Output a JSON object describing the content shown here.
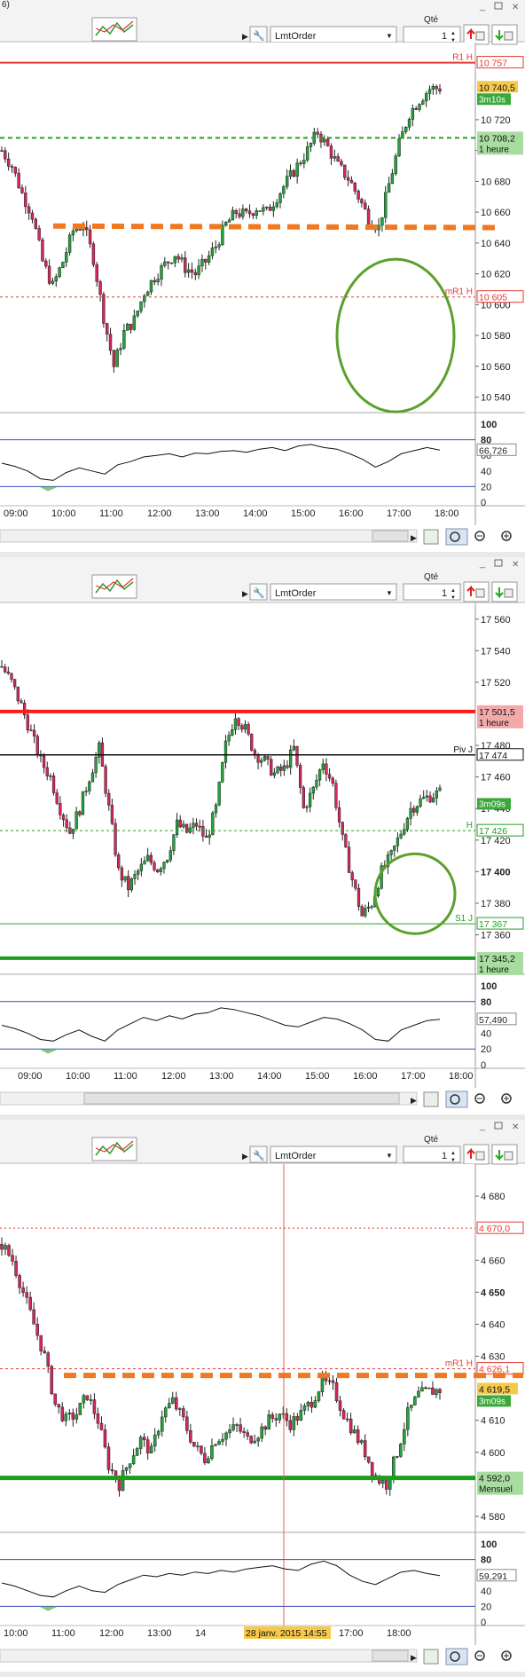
{
  "panels": [
    {
      "window_label": "6)",
      "toolbar": {
        "order_type": "LmtOrder",
        "qty_label": "Qté",
        "qty_value": "1"
      },
      "price_axis": [
        {
          "v": 10720,
          "t": "10 720"
        },
        {
          "v": 10700,
          "t": "10 700"
        },
        {
          "v": 10680,
          "t": "10 680"
        },
        {
          "v": 10660,
          "t": "10 660"
        },
        {
          "v": 10640,
          "t": "10 640"
        },
        {
          "v": 10620,
          "t": "10 620"
        },
        {
          "v": 10600,
          "t": "10 600"
        },
        {
          "v": 10580,
          "t": "10 580"
        },
        {
          "v": 10560,
          "t": "10 560"
        },
        {
          "v": 10540,
          "t": "10 540"
        }
      ],
      "levels": [
        {
          "name": "R1 H",
          "value": 10757,
          "label": "10 757",
          "color": "#e53935",
          "width": 2,
          "dash": "",
          "tag_text": "",
          "tag_bg": ""
        },
        {
          "name": "",
          "value": 10708.2,
          "label": "10 708,2",
          "color": "#22a022",
          "width": 2,
          "dash": "5 4",
          "tag_text": "1 heure",
          "tag_bg": "#a8dca0"
        },
        {
          "name": "mR1 H",
          "value": 10605,
          "label": "10 605",
          "color": "#e53935",
          "width": 1,
          "dash": "3 3",
          "tag_text": "",
          "tag_bg": ""
        }
      ],
      "last_price": {
        "label": "10 740,5",
        "timer": "3m10s"
      },
      "time_labels": [
        "09:00",
        "10:00",
        "11:00",
        "12:00",
        "13:00",
        "14:00",
        "15:00",
        "16:00",
        "17:00",
        "18:00"
      ],
      "osc_axis": [
        "100",
        "80",
        "60",
        "40",
        "20",
        "0"
      ],
      "osc_value": "66,726",
      "chart_data": {
        "type": "candlestick",
        "close_path": [
          10700,
          10690,
          10672,
          10658,
          10628,
          10612,
          10628,
          10648,
          10652,
          10630,
          10592,
          10560,
          10582,
          10590,
          10608,
          10618,
          10626,
          10633,
          10624,
          10620,
          10628,
          10638,
          10652,
          10660,
          10658,
          10663,
          10660,
          10670,
          10680,
          10690,
          10700,
          10712,
          10702,
          10690,
          10682,
          10670,
          10656,
          10650,
          10678,
          10704,
          10724,
          10733,
          10740,
          10740.5
        ],
        "osc_path": [
          50,
          46,
          40,
          30,
          28,
          38,
          44,
          40,
          36,
          48,
          52,
          58,
          60,
          62,
          58,
          63,
          62,
          65,
          66,
          64,
          68,
          70,
          66,
          72,
          74,
          70,
          68,
          62,
          55,
          45,
          52,
          62,
          66,
          70,
          66.7
        ],
        "ylim": [
          10530,
          10770
        ]
      }
    },
    {
      "toolbar": {
        "order_type": "LmtOrder",
        "qty_label": "Qté",
        "qty_value": "1"
      },
      "price_axis": [
        {
          "v": 17560,
          "t": "17 560"
        },
        {
          "v": 17540,
          "t": "17 540"
        },
        {
          "v": 17520,
          "t": "17 520"
        },
        {
          "v": 17480,
          "t": "17 480"
        },
        {
          "v": 17460,
          "t": "17 460"
        },
        {
          "v": 17440,
          "t": "17 440"
        },
        {
          "v": 17420,
          "t": "17 420"
        },
        {
          "v": 17400,
          "t": "17 400"
        },
        {
          "v": 17380,
          "t": "17 380"
        },
        {
          "v": 17360,
          "t": "17 360"
        }
      ],
      "levels": [
        {
          "name": "",
          "value": 17501.5,
          "label": "17 501,5",
          "color": "#ff1a1a",
          "width": 4,
          "dash": "",
          "tag_text": "1 heure",
          "tag_bg": "#f4a9a9"
        },
        {
          "name": "Piv J",
          "value": 17474,
          "label": "17 474",
          "color": "#111111",
          "width": 1.5,
          "dash": "",
          "tag_text": "",
          "tag_bg": ""
        },
        {
          "name": "H",
          "value": 17426,
          "label": "17 426",
          "color": "#22a022",
          "width": 1,
          "dash": "3 3",
          "tag_text": "",
          "tag_bg": ""
        },
        {
          "name": "S1 J",
          "value": 17367,
          "label": "17 367",
          "color": "#22a022",
          "width": 1,
          "dash": "",
          "tag_text": "",
          "tag_bg": ""
        },
        {
          "name": "",
          "value": 17345.2,
          "label": "17 345,2",
          "color": "#1e9e1e",
          "width": 4,
          "dash": "",
          "tag_text": "1 heure",
          "tag_bg": "#a8dca0"
        }
      ],
      "last_price": {
        "label": "",
        "timer": "3m09s"
      },
      "time_labels": [
        "09:00",
        "10:00",
        "11:00",
        "12:00",
        "13:00",
        "14:00",
        "15:00",
        "16:00",
        "17:00",
        "18:00"
      ],
      "osc_axis": [
        "100",
        "80",
        "60",
        "40",
        "20",
        "0"
      ],
      "osc_value": "57,490",
      "chart_data": {
        "type": "candlestick",
        "close_path": [
          17530,
          17520,
          17505,
          17488,
          17470,
          17460,
          17440,
          17425,
          17440,
          17460,
          17478,
          17440,
          17400,
          17390,
          17400,
          17408,
          17402,
          17410,
          17430,
          17425,
          17430,
          17420,
          17440,
          17480,
          17500,
          17490,
          17475,
          17470,
          17462,
          17465,
          17478,
          17440,
          17452,
          17470,
          17455,
          17420,
          17395,
          17372,
          17380,
          17400,
          17410,
          17425,
          17440,
          17445,
          17448,
          17450
        ],
        "osc_path": [
          50,
          46,
          40,
          32,
          30,
          38,
          44,
          36,
          30,
          44,
          52,
          60,
          56,
          62,
          58,
          64,
          66,
          72,
          70,
          66,
          62,
          56,
          50,
          48,
          54,
          60,
          58,
          52,
          44,
          32,
          30,
          44,
          50,
          56,
          57.5
        ],
        "ylim": [
          17335,
          17570
        ]
      }
    },
    {
      "toolbar": {
        "order_type": "LmtOrder",
        "qty_label": "Qté",
        "qty_value": "1"
      },
      "price_axis": [
        {
          "v": 4680,
          "t": "4 680"
        },
        {
          "v": 4660,
          "t": "4 660"
        },
        {
          "v": 4650,
          "t": "4 650"
        },
        {
          "v": 4640,
          "t": "4 640"
        },
        {
          "v": 4630,
          "t": "4 630"
        },
        {
          "v": 4610,
          "t": "4 610"
        },
        {
          "v": 4600,
          "t": "4 600"
        },
        {
          "v": 4580,
          "t": "4 580"
        }
      ],
      "levels": [
        {
          "name": "",
          "value": 4670,
          "label": "4 670,0",
          "color": "#e53935",
          "width": 1,
          "dash": "2 3",
          "tag_text": "",
          "tag_bg": ""
        },
        {
          "name": "mR1 H",
          "value": 4626.1,
          "label": "4 626,1",
          "color": "#e53935",
          "width": 1,
          "dash": "3 3",
          "tag_text": "",
          "tag_bg": ""
        },
        {
          "name": "",
          "value": 4592,
          "label": "4 592,0",
          "color": "#1e9e1e",
          "width": 5,
          "dash": "",
          "tag_text": "Mensuel",
          "tag_bg": "#a8dca0"
        }
      ],
      "last_price": {
        "label": "4 619,5",
        "timer": "3m09s"
      },
      "time_labels": [
        "10:00",
        "11:00",
        "12:00",
        "13:00",
        "14",
        "",
        "16:00",
        "17:00",
        "18:00"
      ],
      "osc_axis": [
        "100",
        "80",
        "60",
        "40",
        "20",
        "0"
      ],
      "osc_value": "59,291",
      "crosshair_label": "28 janv. 2015 14:55",
      "chart_data": {
        "type": "candlestick",
        "close_path": [
          4665,
          4660,
          4650,
          4640,
          4630,
          4615,
          4610,
          4612,
          4618,
          4610,
          4596,
          4590,
          4598,
          4604,
          4600,
          4612,
          4616,
          4610,
          4602,
          4598,
          4604,
          4606,
          4608,
          4604,
          4606,
          4610,
          4612,
          4609,
          4612,
          4616,
          4622,
          4620,
          4612,
          4606,
          4600,
          4592,
          4590,
          4600,
          4612,
          4618,
          4619,
          4619.5
        ],
        "osc_path": [
          50,
          46,
          40,
          34,
          32,
          40,
          46,
          40,
          38,
          48,
          54,
          60,
          58,
          62,
          60,
          64,
          62,
          66,
          64,
          68,
          70,
          72,
          68,
          66,
          74,
          78,
          72,
          60,
          52,
          48,
          56,
          64,
          66,
          62,
          59.3
        ],
        "ylim": [
          4575,
          4690
        ]
      }
    }
  ]
}
